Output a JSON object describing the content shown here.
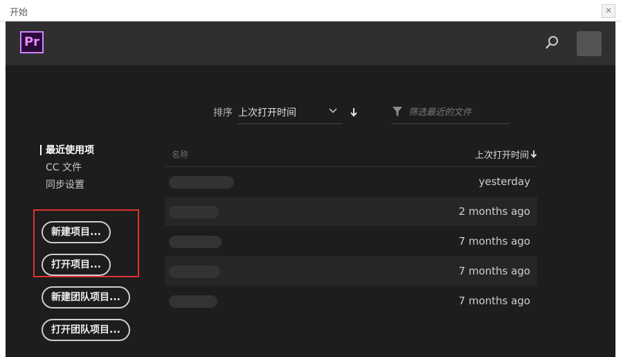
{
  "window": {
    "title": "开始",
    "close_label": "✕"
  },
  "header": {
    "logo": "Pr",
    "search_icon": "search-icon",
    "avatar_icon": "avatar"
  },
  "sort": {
    "label": "排序",
    "value": "上次打开时间"
  },
  "filter": {
    "placeholder": "筛选最近的文件"
  },
  "sidebar": {
    "items": [
      {
        "label": "最近使用项",
        "active": true
      },
      {
        "label": "CC 文件",
        "active": false
      },
      {
        "label": "同步设置",
        "active": false
      }
    ],
    "buttons": [
      {
        "label": "新建项目..."
      },
      {
        "label": "打开项目..."
      },
      {
        "label": "新建团队项目..."
      },
      {
        "label": "打开团队项目..."
      }
    ]
  },
  "table": {
    "columns": {
      "name": "名称",
      "date": "上次打开时间"
    },
    "rows": [
      {
        "date": "yesterday"
      },
      {
        "date": "2 months ago"
      },
      {
        "date": "7 months ago"
      },
      {
        "date": "7 months ago"
      },
      {
        "date": "7 months ago"
      }
    ]
  },
  "colors": {
    "accent_pr": "#d885ff",
    "highlight": "#e0302f",
    "bg": "#1d1d1d",
    "header_bg": "#2f2f2f"
  }
}
